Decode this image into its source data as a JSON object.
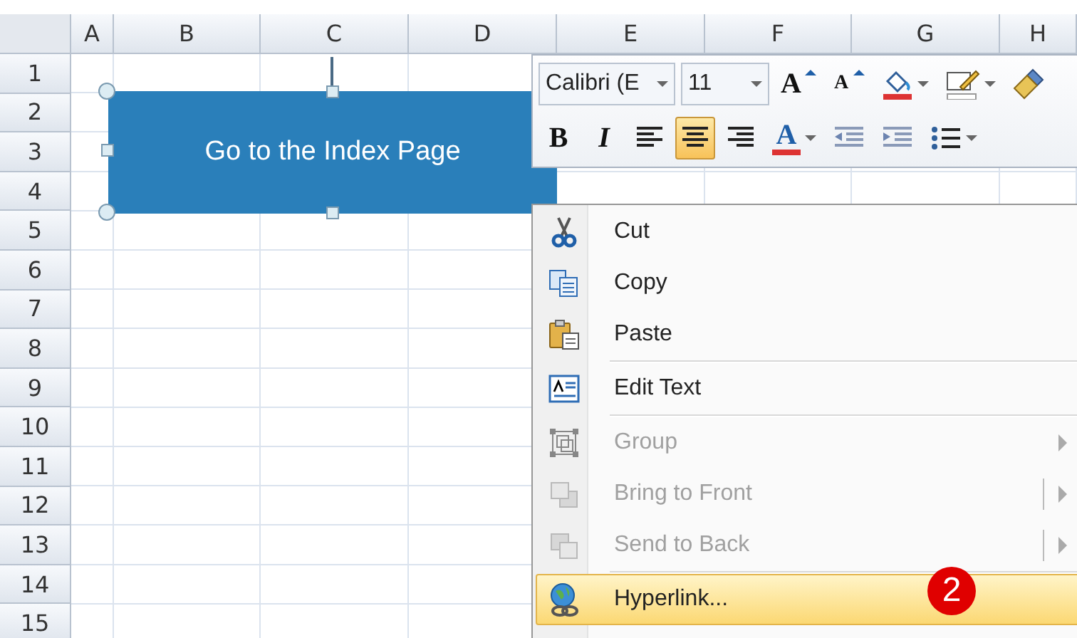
{
  "sheet": {
    "columns": [
      "A",
      "B",
      "C",
      "D",
      "E",
      "F",
      "G",
      "H"
    ],
    "rows": [
      "1",
      "2",
      "3",
      "4",
      "5",
      "6",
      "7",
      "8",
      "9",
      "10",
      "11",
      "12",
      "13",
      "14",
      "15"
    ]
  },
  "shape": {
    "text": "Go to the Index Page",
    "selected": true
  },
  "mini_toolbar": {
    "font": "Calibri (E",
    "size": "11",
    "row1": [
      {
        "kind": "grow",
        "glyph": "A"
      },
      {
        "kind": "shrink",
        "glyph": "A"
      },
      {
        "kind": "fill",
        "dropdown": true
      },
      {
        "kind": "border",
        "dropdown": true
      },
      {
        "kind": "painter"
      }
    ],
    "row2": [
      {
        "kind": "bold",
        "glyph": "B",
        "selected": false
      },
      {
        "kind": "italic",
        "glyph": "I",
        "selected": false
      },
      {
        "kind": "align-left",
        "selected": false
      },
      {
        "kind": "align-center",
        "selected": true
      },
      {
        "kind": "align-right",
        "selected": false
      },
      {
        "kind": "font-color",
        "glyph": "A",
        "selected": false,
        "dropdown": true
      },
      {
        "kind": "outdent",
        "selected": false
      },
      {
        "kind": "indent",
        "selected": false
      },
      {
        "kind": "bullets",
        "selected": false,
        "dropdown": true
      }
    ]
  },
  "context_menu": [
    {
      "kind": "item",
      "label": "Cut",
      "disabled": false,
      "selected": false
    },
    {
      "kind": "item",
      "label": "Copy",
      "disabled": false,
      "selected": false
    },
    {
      "kind": "item",
      "label": "Paste",
      "disabled": false,
      "selected": false
    },
    {
      "kind": "separator"
    },
    {
      "kind": "item",
      "label": "Edit Text",
      "disabled": false,
      "selected": false
    },
    {
      "kind": "separator"
    },
    {
      "kind": "item",
      "label": "Group",
      "disabled": true,
      "selected": false,
      "submenu": true
    },
    {
      "kind": "item",
      "label": "Bring to Front",
      "disabled": true,
      "selected": false,
      "submenu": true,
      "split": true
    },
    {
      "kind": "item",
      "label": "Send to Back",
      "disabled": true,
      "selected": false,
      "submenu": true,
      "split": true
    },
    {
      "kind": "separator"
    },
    {
      "kind": "item",
      "label": "Hyperlink...",
      "disabled": false,
      "selected": true
    }
  ],
  "badge": "2"
}
